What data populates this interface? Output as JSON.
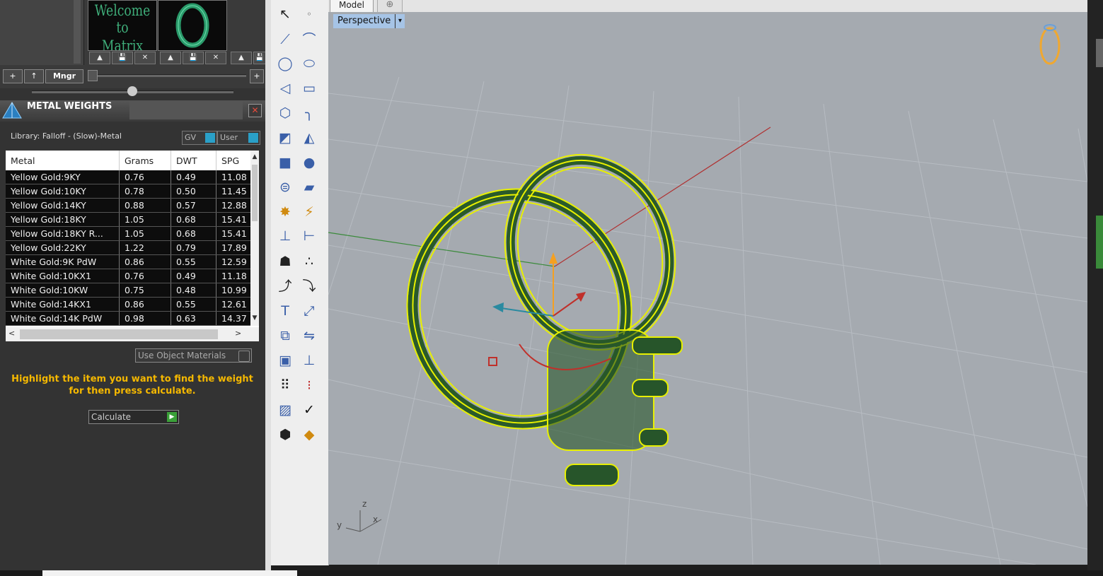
{
  "thumbnails": [
    {
      "caption": "Welcome to Matrix",
      "line1": "Welcome to",
      "line2": "Matrix"
    },
    {
      "caption": "",
      "line1": "",
      "line2": ""
    }
  ],
  "thumb_buttons": [
    "▲",
    "💾",
    "✕"
  ],
  "library_toolbar": {
    "add": "+",
    "up": "↑",
    "manager": "Mngr",
    "plus": "+"
  },
  "panel": {
    "title": "METAL WEIGHTS",
    "close": "✕",
    "library_label": "Library: Falloff - (Slow)-Metal",
    "gv_label": "GV",
    "user_label": "User"
  },
  "table": {
    "columns": [
      "Metal",
      "Grams",
      "DWT",
      "SPG"
    ],
    "rows": [
      [
        "Yellow Gold:9KY",
        "0.76",
        "0.49",
        "11.08"
      ],
      [
        "Yellow Gold:10KY",
        "0.78",
        "0.50",
        "11.45"
      ],
      [
        "Yellow Gold:14KY",
        "0.88",
        "0.57",
        "12.88"
      ],
      [
        "Yellow Gold:18KY",
        "1.05",
        "0.68",
        "15.41"
      ],
      [
        "Yellow Gold:18KY R...",
        "1.05",
        "0.68",
        "15.41"
      ],
      [
        "Yellow Gold:22KY",
        "1.22",
        "0.79",
        "17.89"
      ],
      [
        "White Gold:9K PdW",
        "0.86",
        "0.55",
        "12.59"
      ],
      [
        "White Gold:10KX1",
        "0.76",
        "0.49",
        "11.18"
      ],
      [
        "White Gold:10KW",
        "0.75",
        "0.48",
        "10.99"
      ],
      [
        "White Gold:14KX1",
        "0.86",
        "0.55",
        "12.61"
      ],
      [
        "White Gold:14K PdW",
        "0.98",
        "0.63",
        "14.37"
      ]
    ]
  },
  "use_object_materials": "Use Object Materials",
  "hint": "Highlight the item you want to find the weight for then press calculate.",
  "calculate_label": "Calculate",
  "tabs": {
    "model": "Model",
    "add": "⊕"
  },
  "viewport": {
    "name": "Perspective",
    "dropdown": "▾",
    "axis_x": "x",
    "axis_y": "y",
    "axis_z": "z"
  },
  "colors": {
    "accent_yellow": "#f5b800",
    "wire_yellow": "#e8f000",
    "axis_red": "#c0392b",
    "axis_green": "#3a8a3a",
    "viewport_bg": "#a5aab0"
  }
}
